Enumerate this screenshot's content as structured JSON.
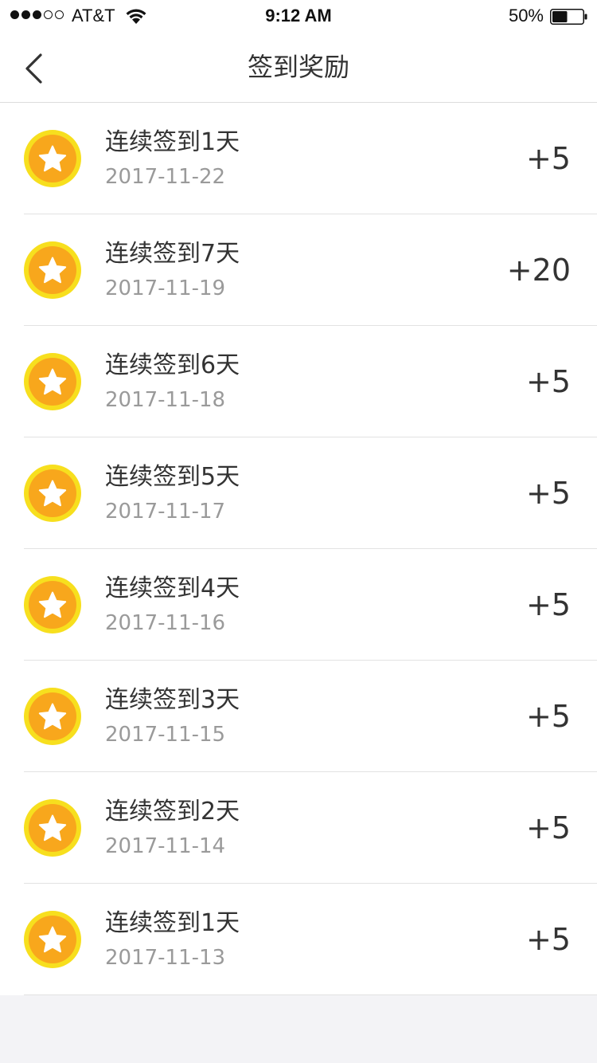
{
  "status_bar": {
    "carrier": "AT&T",
    "time": "9:12 AM",
    "battery": "50%",
    "battery_level": 0.5,
    "signal_bars": 3,
    "signal_total": 5
  },
  "nav": {
    "title": "签到奖励",
    "back_icon": "chevron-left-icon"
  },
  "colors": {
    "coin_outer": "#f7df1e",
    "coin_inner": "#f8a71c",
    "star": "#ffffff",
    "separator": "#e2e2e2",
    "date_text": "#9a9a9a",
    "background": "#f3f3f6"
  },
  "rewards": [
    {
      "title": "连续签到1天",
      "date": "2017-11-22",
      "points": "+5",
      "icon": "star-coin-icon"
    },
    {
      "title": "连续签到7天",
      "date": "2017-11-19",
      "points": "+20",
      "icon": "star-coin-icon"
    },
    {
      "title": "连续签到6天",
      "date": "2017-11-18",
      "points": "+5",
      "icon": "star-coin-icon"
    },
    {
      "title": "连续签到5天",
      "date": "2017-11-17",
      "points": "+5",
      "icon": "star-coin-icon"
    },
    {
      "title": "连续签到4天",
      "date": "2017-11-16",
      "points": "+5",
      "icon": "star-coin-icon"
    },
    {
      "title": "连续签到3天",
      "date": "2017-11-15",
      "points": "+5",
      "icon": "star-coin-icon"
    },
    {
      "title": "连续签到2天",
      "date": "2017-11-14",
      "points": "+5",
      "icon": "star-coin-icon"
    },
    {
      "title": "连续签到1天",
      "date": "2017-11-13",
      "points": "+5",
      "icon": "star-coin-icon"
    }
  ]
}
